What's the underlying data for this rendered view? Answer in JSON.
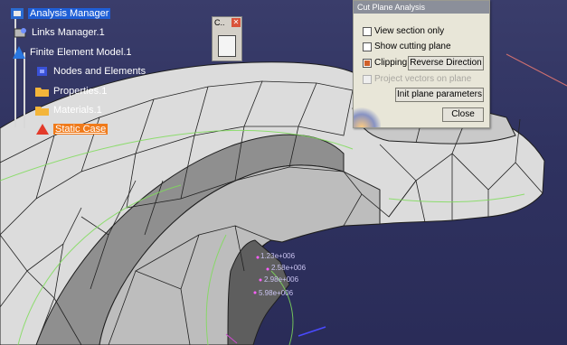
{
  "spec_tree": {
    "analysis_manager": "Analysis Manager",
    "links_manager": "Links Manager.1",
    "fem_model": "Finite Element Model.1",
    "nodes_elements": "Nodes and Elements",
    "properties": "Properties.1",
    "materials": "Materials.1",
    "static_case": "Static Case"
  },
  "mini_window": {
    "title": "C.."
  },
  "cut_plane_dialog": {
    "title": "Cut Plane Analysis",
    "view_section_only": {
      "label": "View section only",
      "checked": false
    },
    "show_cutting_plane": {
      "label": "Show cutting plane",
      "checked": false
    },
    "clipping": {
      "label": "Clipping",
      "checked": true
    },
    "reverse_direction": "Reverse Direction",
    "project_vectors": {
      "label": "Project vectors on plane",
      "enabled": false
    },
    "init_plane_parameters": "Init plane parameters",
    "close": "Close"
  },
  "value_labels": [
    "1.23e+006",
    "2.58e+006",
    "2.98e+006",
    "5.98e+006"
  ],
  "colors": {
    "background": "#2f3260",
    "selection_blue": "#1f5fd6",
    "selection_orange": "#f07a1a",
    "mesh_edge": "#222222",
    "contour_green": "#7fdc5a"
  }
}
